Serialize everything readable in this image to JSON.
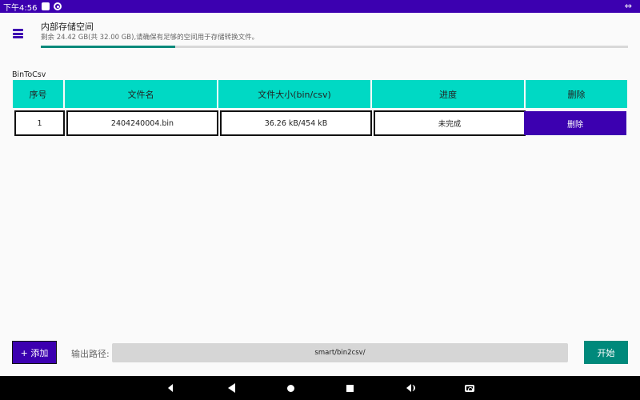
{
  "status_bar": {
    "time": "下午4:56",
    "right_icon": "⇔"
  },
  "storage": {
    "icon": "storage-list-icon",
    "title": "内部存储空间",
    "description": "剩余 24.42 GB(共 32.00 GB),请确保有足够的空间用于存储转换文件。",
    "used_fraction": 0.229
  },
  "section_label": "BinToCsv",
  "table": {
    "headers": [
      "序号",
      "文件名",
      "文件大小(bin/csv)",
      "进度",
      "删除"
    ],
    "rows": [
      {
        "index": "1",
        "filename": "2404240004.bin",
        "size": "36.26 kB/454 kB",
        "progress": "未完成",
        "delete_label": "删除"
      }
    ]
  },
  "bottom": {
    "add_label": "+ 添加",
    "path_label": "输出路径:",
    "path_value": "smart/bin2csv/",
    "start_label": "开始"
  },
  "colors": {
    "primary": "#3c00b0",
    "teal_header": "#00d9c4",
    "accent": "#00897b"
  }
}
